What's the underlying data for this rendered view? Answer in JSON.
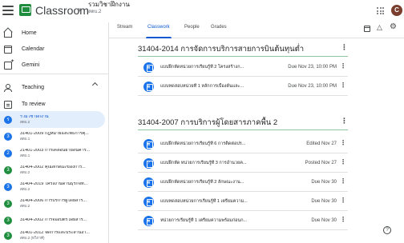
{
  "header": {
    "app_title": "Classroom",
    "breadcrumb_title": "รวมวิชาฝึกงาน",
    "breadcrumb_sub": "สดบ.2",
    "avatar_letter": "C",
    "menu_icon": "menu-icon",
    "apps_icon": "apps-grid-icon"
  },
  "sidebar": {
    "nav": [
      {
        "label": "Home",
        "icon": "home-icon"
      },
      {
        "label": "Calendar",
        "icon": "calendar-icon"
      },
      {
        "label": "Gemini",
        "icon": "gemini-icon"
      }
    ],
    "teaching": {
      "label": "Teaching",
      "icon": "people-icon"
    },
    "to_review": {
      "label": "To review",
      "icon": "review-icon"
    },
    "classes": [
      {
        "badge": "ร",
        "name": "รวมวิชาฝึกงาน",
        "sub": "สดบ.2",
        "color": "#1a73e8",
        "active": true
      },
      {
        "badge": "3",
        "name": "31401-2009 กฎหมายและพิธีการศุ...",
        "sub": "สดบ.1",
        "color": "#1a73e8"
      },
      {
        "badge": "2",
        "name": "21401-2003 การเคลื่อนย้ายสินค้าร...",
        "sub": "สดบ.1",
        "color": "#1a73e8"
      },
      {
        "badge": "3",
        "name": "31404-2002 คุณลักษณะของการ...",
        "sub": "สดบ.2",
        "color": "#1e8e3e"
      },
      {
        "badge": "3",
        "name": "31404-2019 โครงงานด้านธุรกิจท...",
        "sub": "สดบ.2",
        "color": "#1a73e8"
      },
      {
        "badge": "3",
        "name": "31404-2006 การบริการผู้โดยสาร...",
        "sub": "สดบ.2",
        "color": "#1e8e3e"
      },
      {
        "badge": "3",
        "name": "31404-2002 การจองบัตรโดยสาร...",
        "sub": "",
        "color": "#1e8e3e"
      },
      {
        "badge": "3",
        "name": "31401-2012 จัดการและประสานงา...",
        "sub": "สดบ.2 (ทวิภาคี)",
        "color": "#1e8e3e"
      }
    ]
  },
  "tabs": {
    "items": [
      "Stream",
      "Classwork",
      "People",
      "Grades"
    ],
    "active": "Classwork"
  },
  "topics": [
    {
      "title": "31404-2014 การจัดการบริการสายการบินต้นทุนต่ำ",
      "items": [
        {
          "title": "แบบฝึกหัดหน่วยการเรียนรู้ที่ 2 โครงสร้างก...",
          "due": "Due Nov 23, 10:00 PM",
          "type": "assignment"
        },
        {
          "title": "แบบทดสอบหน่วยที่ 1 หลักการเบื้องต้นและ...",
          "due": "Due Nov 23, 10:00 PM",
          "type": "assignment"
        }
      ]
    },
    {
      "title": "31404-2007 การบริการผู้โดยสารภาคพื้น 2",
      "items": [
        {
          "title": "แบบฝึกหัดหน่วยการเรียนรู้ที่ 6 การติดต่อปร...",
          "due": "Edited Nov 27",
          "type": "assignment"
        },
        {
          "title": "แบบฝึกหัด หน่วยการเรียนรู้ที่ 3 การอำนวยค...",
          "due": "Posted Nov 27",
          "type": "quiz"
        },
        {
          "title": "แบบฝึกหัดหน่วยการเรียนรู้ที่ 2 ลักษณะงาน...",
          "due": "Due Nov 30",
          "type": "assignment"
        },
        {
          "title": "แบบทดสอบหน่วยการเรียนรู้ที่ 1 เตรียมความ...",
          "due": "Due Nov 30",
          "type": "assignment"
        },
        {
          "title": "หน่วยการเรียนรู้ที่ 1 เตรียมความพร้อมก่อนก...",
          "due": "Due Nov 30",
          "type": "assignment"
        }
      ]
    }
  ],
  "help_label": "?"
}
